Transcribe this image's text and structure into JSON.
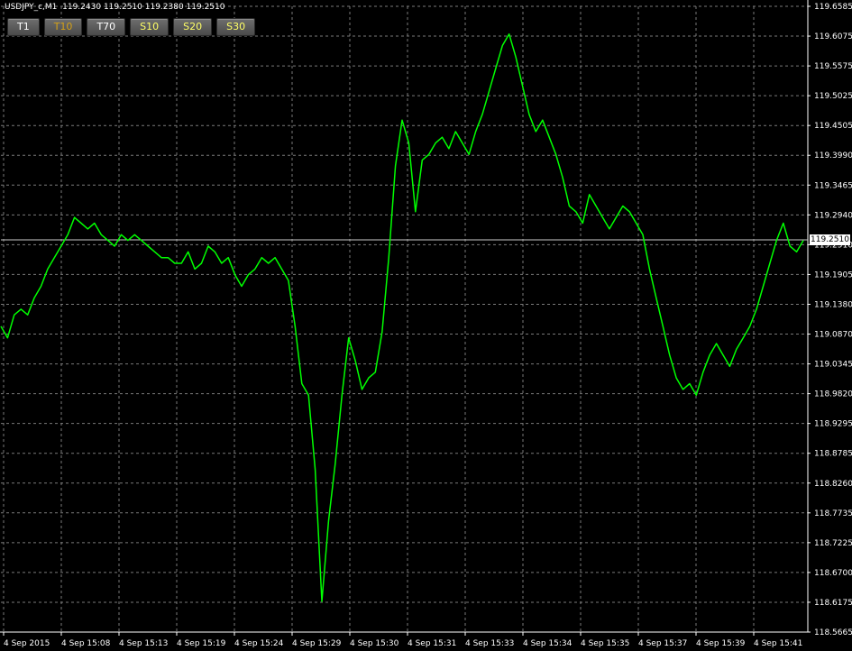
{
  "header": {
    "symbol_line": "USDJPY_c,M1  119.2430 119.2510 119.2380 119.2510"
  },
  "timeframe_buttons": [
    {
      "label": "T1",
      "color": "#ffffff"
    },
    {
      "label": "T10",
      "color": "#d4a017"
    },
    {
      "label": "T70",
      "color": "#ffffff"
    },
    {
      "label": "S10",
      "color": "#ffff66"
    },
    {
      "label": "S20",
      "color": "#ffff66"
    },
    {
      "label": "S30",
      "color": "#ffff66"
    }
  ],
  "current_price": "119.2510",
  "colors": {
    "background": "#000000",
    "line": "#00ff00",
    "grid": "#7a7a7a",
    "axis": "#ffffff"
  },
  "chart_data": {
    "type": "line",
    "title": "",
    "xlabel": "",
    "ylabel": "",
    "ylim": [
      118.5665,
      119.6585
    ],
    "y_ticks": [
      "119.6585",
      "119.6075",
      "119.5575",
      "119.5025",
      "119.4505",
      "119.3990",
      "119.3465",
      "119.2940",
      "119.2510",
      "119.1905",
      "119.1380",
      "119.0870",
      "119.0345",
      "118.9820",
      "118.9295",
      "118.8785",
      "118.8260",
      "118.7735",
      "118.7225",
      "118.6700",
      "118.6175",
      "118.5665"
    ],
    "x_ticks": [
      "4 Sep 2015",
      "4 Sep 15:08",
      "4 Sep 15:13",
      "4 Sep 15:19",
      "4 Sep 15:24",
      "4 Sep 15:29",
      "4 Sep 15:30",
      "4 Sep 15:31",
      "4 Sep 15:33",
      "4 Sep 15:34",
      "4 Sep 15:35",
      "4 Sep 15:37",
      "4 Sep 15:39",
      "4 Sep 15:41"
    ],
    "grid": true,
    "series": [
      {
        "values": [
          119.1,
          119.08,
          119.12,
          119.13,
          119.12,
          119.15,
          119.17,
          119.2,
          119.22,
          119.24,
          119.26,
          119.29,
          119.28,
          119.27,
          119.28,
          119.26,
          119.25,
          119.24,
          119.26,
          119.25,
          119.26,
          119.25,
          119.24,
          119.23,
          119.22,
          119.22,
          119.21,
          119.21,
          119.23,
          119.2,
          119.21,
          119.24,
          119.23,
          119.21,
          119.22,
          119.19,
          119.17,
          119.19,
          119.2,
          119.22,
          119.21,
          119.22,
          119.2,
          119.18,
          119.1,
          119.0,
          118.98,
          118.85,
          118.62,
          118.76,
          118.86,
          118.98,
          119.08,
          119.04,
          118.99,
          119.01,
          119.02,
          119.09,
          119.22,
          119.38,
          119.46,
          119.42,
          119.3,
          119.39,
          119.4,
          119.42,
          119.43,
          119.41,
          119.44,
          119.42,
          119.4,
          119.44,
          119.47,
          119.51,
          119.55,
          119.59,
          119.61,
          119.57,
          119.52,
          119.47,
          119.44,
          119.46,
          119.43,
          119.4,
          119.36,
          119.31,
          119.3,
          119.28,
          119.33,
          119.31,
          119.29,
          119.27,
          119.29,
          119.31,
          119.3,
          119.28,
          119.26,
          119.2,
          119.15,
          119.1,
          119.05,
          119.01,
          118.99,
          119.0,
          118.98,
          119.02,
          119.05,
          119.07,
          119.05,
          119.03,
          119.06,
          119.08,
          119.1,
          119.13,
          119.17,
          119.21,
          119.25,
          119.28,
          119.24,
          119.23,
          119.25
        ]
      }
    ]
  }
}
